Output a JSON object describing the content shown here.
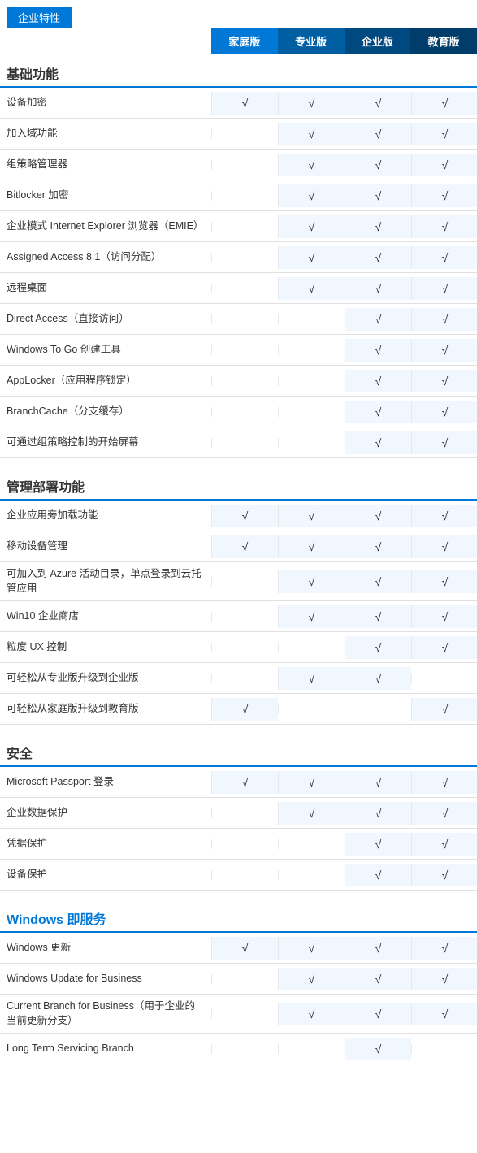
{
  "header": {
    "tag": "企业特性"
  },
  "columns": {
    "headers": [
      "家庭版",
      "专业版",
      "企业版",
      "教育版"
    ]
  },
  "sections": [
    {
      "title": "基础功能",
      "blue_text": false,
      "rows": [
        {
          "name": "设备加密",
          "cells": [
            1,
            1,
            1,
            1
          ]
        },
        {
          "name": "加入域功能",
          "cells": [
            0,
            1,
            1,
            1
          ]
        },
        {
          "name": "组策略管理器",
          "cells": [
            0,
            1,
            1,
            1
          ]
        },
        {
          "name": "Bitlocker 加密",
          "cells": [
            0,
            1,
            1,
            1
          ]
        },
        {
          "name": "企业模式 Internet Explorer 浏览器（EMIE）",
          "cells": [
            0,
            1,
            1,
            1
          ]
        },
        {
          "name": "Assigned Access 8.1（访问分配）",
          "cells": [
            0,
            1,
            1,
            1
          ]
        },
        {
          "name": "远程桌面",
          "cells": [
            0,
            1,
            1,
            1
          ]
        },
        {
          "name": "Direct Access（直接访问）",
          "cells": [
            0,
            0,
            1,
            1
          ]
        },
        {
          "name": "Windows To Go 创建工具",
          "cells": [
            0,
            0,
            1,
            1
          ]
        },
        {
          "name": "AppLocker（应用程序锁定）",
          "cells": [
            0,
            0,
            1,
            1
          ]
        },
        {
          "name": "BranchCache（分支缓存）",
          "cells": [
            0,
            0,
            1,
            1
          ]
        },
        {
          "name": "可通过组策略控制的开始屏幕",
          "cells": [
            0,
            0,
            1,
            1
          ]
        }
      ]
    },
    {
      "title": "管理部署功能",
      "blue_text": false,
      "rows": [
        {
          "name": "企业应用旁加载功能",
          "cells": [
            1,
            1,
            1,
            1
          ]
        },
        {
          "name": "移动设备管理",
          "cells": [
            1,
            1,
            1,
            1
          ]
        },
        {
          "name": "可加入到 Azure 活动目录，单点登录到云托管应用",
          "cells": [
            0,
            1,
            1,
            1
          ]
        },
        {
          "name": "Win10 企业商店",
          "cells": [
            0,
            1,
            1,
            1
          ]
        },
        {
          "name": "粒度 UX 控制",
          "cells": [
            0,
            0,
            1,
            1
          ]
        },
        {
          "name": "可轻松从专业版升级到企业版",
          "cells": [
            0,
            1,
            1,
            0
          ]
        },
        {
          "name": "可轻松从家庭版升级到教育版",
          "cells": [
            1,
            0,
            0,
            1
          ]
        }
      ]
    },
    {
      "title": "安全",
      "blue_text": false,
      "rows": [
        {
          "name": "Microsoft Passport 登录",
          "cells": [
            1,
            1,
            1,
            1
          ]
        },
        {
          "name": "企业数据保护",
          "cells": [
            0,
            1,
            1,
            1
          ]
        },
        {
          "name": "凭据保护",
          "cells": [
            0,
            0,
            1,
            1
          ]
        },
        {
          "name": "设备保护",
          "cells": [
            0,
            0,
            1,
            1
          ]
        }
      ]
    },
    {
      "title": "Windows 即服务",
      "blue_text": true,
      "rows": [
        {
          "name": "Windows 更新",
          "cells": [
            1,
            1,
            1,
            1
          ]
        },
        {
          "name": "Windows Update for Business",
          "cells": [
            0,
            1,
            1,
            1
          ]
        },
        {
          "name": "Current Branch for Business（用于企业的当前更新分支）",
          "cells": [
            0,
            1,
            1,
            1
          ]
        },
        {
          "name": "Long Term Servicing Branch",
          "cells": [
            0,
            0,
            1,
            0
          ]
        }
      ]
    }
  ]
}
